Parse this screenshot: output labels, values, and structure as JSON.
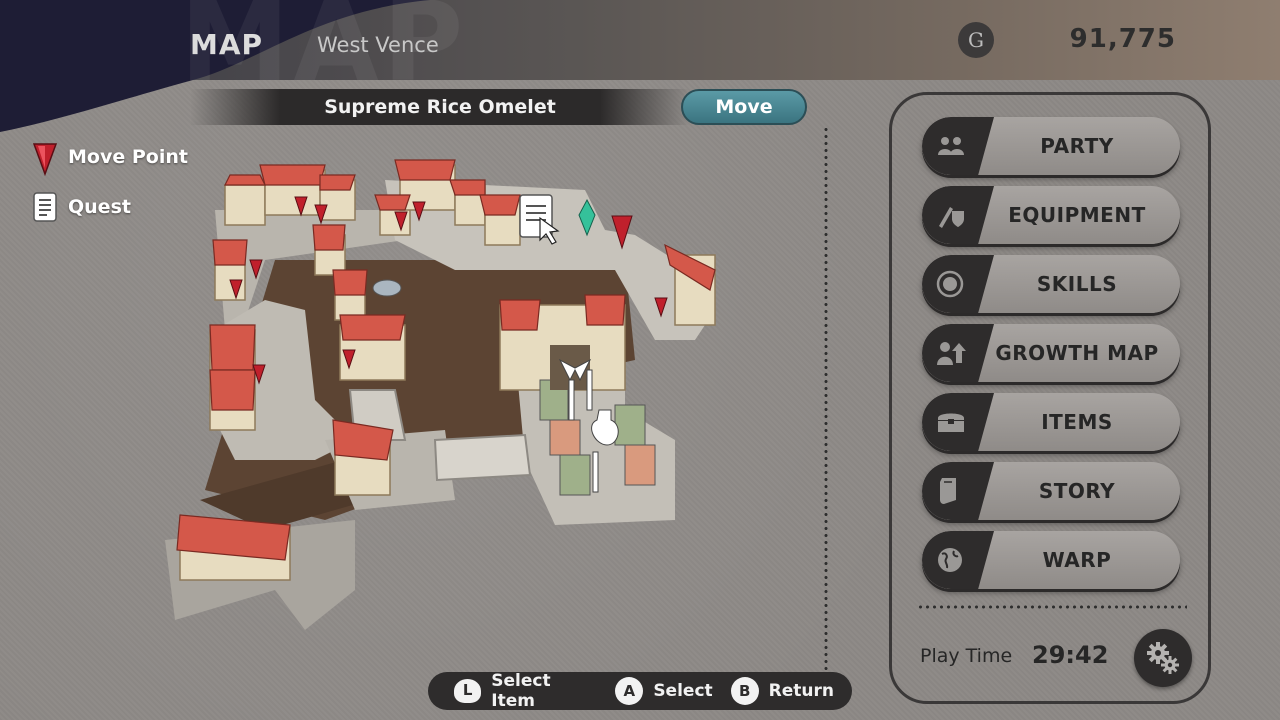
{
  "header": {
    "background_word": "MAP",
    "title": "MAP",
    "location": "West Vence",
    "currency_icon": "G",
    "currency_amount": "91,775"
  },
  "dish_bar": {
    "dish_name": "Supreme Rice Omelet",
    "move_label": "Move",
    "move_color": "#4a8794"
  },
  "legend": {
    "items": [
      {
        "icon": "move-point-pin-icon",
        "label": "Move Point",
        "color": "#c0202c"
      },
      {
        "icon": "quest-scroll-icon",
        "label": "Quest",
        "color": "#ffffff"
      }
    ]
  },
  "map": {
    "name": "West Vence town map",
    "move_points": 12,
    "quests": 1,
    "markers": [
      "move-point-pin-icon",
      "quest-scroll-icon",
      "crystal-icon",
      "sword-icon",
      "potion-icon"
    ]
  },
  "menu": {
    "items": [
      {
        "label": "PARTY",
        "icon": "party-icon"
      },
      {
        "label": "EQUIPMENT",
        "icon": "equipment-icon"
      },
      {
        "label": "SKILLS",
        "icon": "skills-icon"
      },
      {
        "label": "GROWTH MAP",
        "icon": "growth-map-icon"
      },
      {
        "label": "ITEMS",
        "icon": "items-chest-icon"
      },
      {
        "label": "STORY",
        "icon": "story-book-icon"
      },
      {
        "label": "WARP",
        "icon": "warp-globe-icon"
      }
    ],
    "playtime_label": "Play Time",
    "playtime_value": "29:42",
    "settings_icon": "settings-gears-icon"
  },
  "hints": [
    {
      "key": "L",
      "label": "Select Item"
    },
    {
      "key": "A",
      "label": "Select"
    },
    {
      "key": "B",
      "label": "Return"
    }
  ]
}
